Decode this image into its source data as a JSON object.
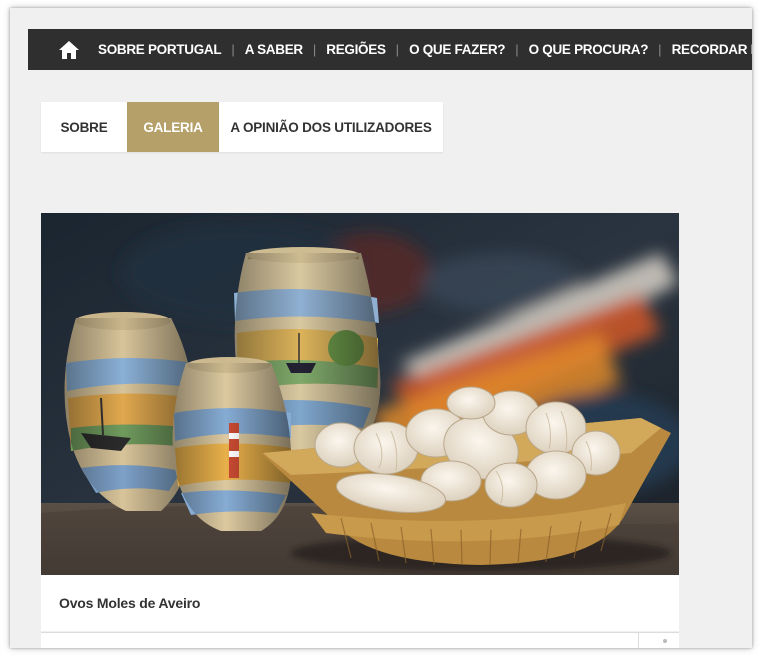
{
  "nav": {
    "home_icon": "home-icon",
    "items": [
      {
        "label": "SOBRE PORTUGAL"
      },
      {
        "label": "A SABER"
      },
      {
        "label": "REGIÕES"
      },
      {
        "label": "O QUE FAZER?"
      },
      {
        "label": "O QUE PROCURA?"
      },
      {
        "label": "RECORDAR E PARTILHAR"
      }
    ],
    "separator": "|"
  },
  "tabs": [
    {
      "label": "SOBRE",
      "active": false
    },
    {
      "label": "GALERIA",
      "active": true
    },
    {
      "label": "A OPINIÃO DOS UTILIZADORES",
      "active": false
    }
  ],
  "gallery": {
    "caption": "Ovos Moles de Aveiro"
  },
  "colors": {
    "nav_bg": "#2f2f2f",
    "active_tab": "#b5a06a",
    "page_bg": "#f0f0f0"
  }
}
